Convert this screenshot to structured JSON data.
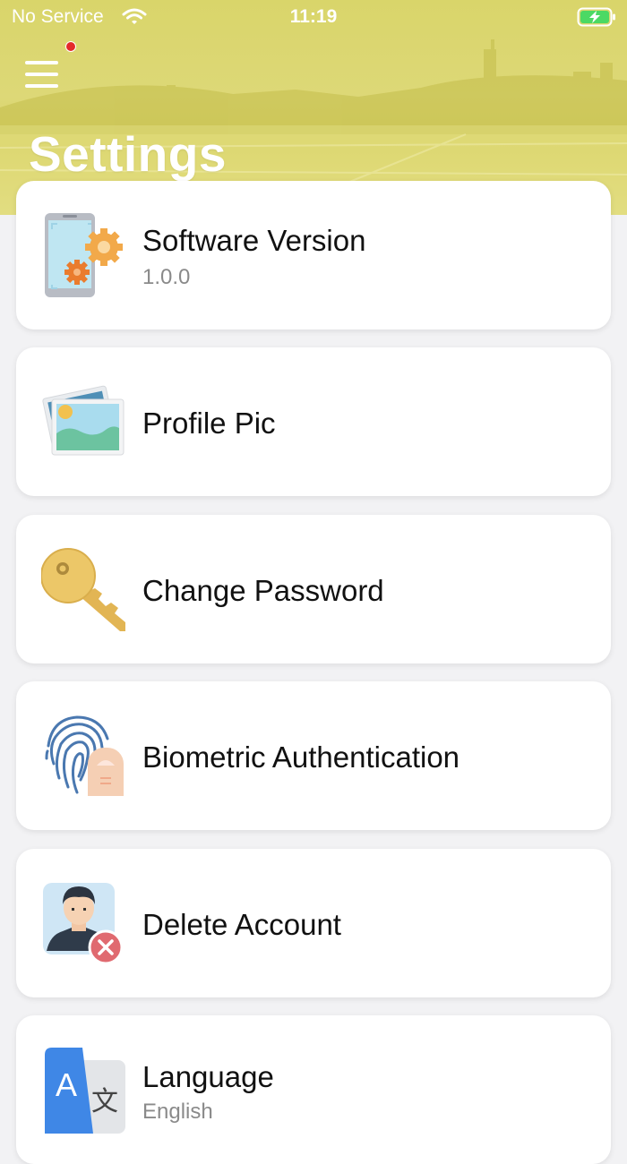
{
  "status_bar": {
    "carrier": "No Service",
    "time": "11:19",
    "wifi_icon": "wifi-icon",
    "battery_icon": "battery-charging-icon",
    "battery_color": "#4cd964"
  },
  "header": {
    "title": "Settings",
    "menu_icon": "hamburger-menu-icon",
    "has_notification": true,
    "background_color": "#dcd773",
    "notification_color": "#e42a2a"
  },
  "settings": [
    {
      "label": "Software Version",
      "subtitle": "1.0.0",
      "icon": "phone-gears-icon"
    },
    {
      "label": "Profile Pic",
      "icon": "photo-gallery-icon"
    },
    {
      "label": "Change Password",
      "icon": "key-icon"
    },
    {
      "label": "Biometric Authentication",
      "icon": "fingerprint-icon"
    },
    {
      "label": "Delete Account",
      "icon": "delete-user-icon"
    },
    {
      "label": "Language",
      "subtitle": "English",
      "icon": "translate-icon"
    }
  ]
}
